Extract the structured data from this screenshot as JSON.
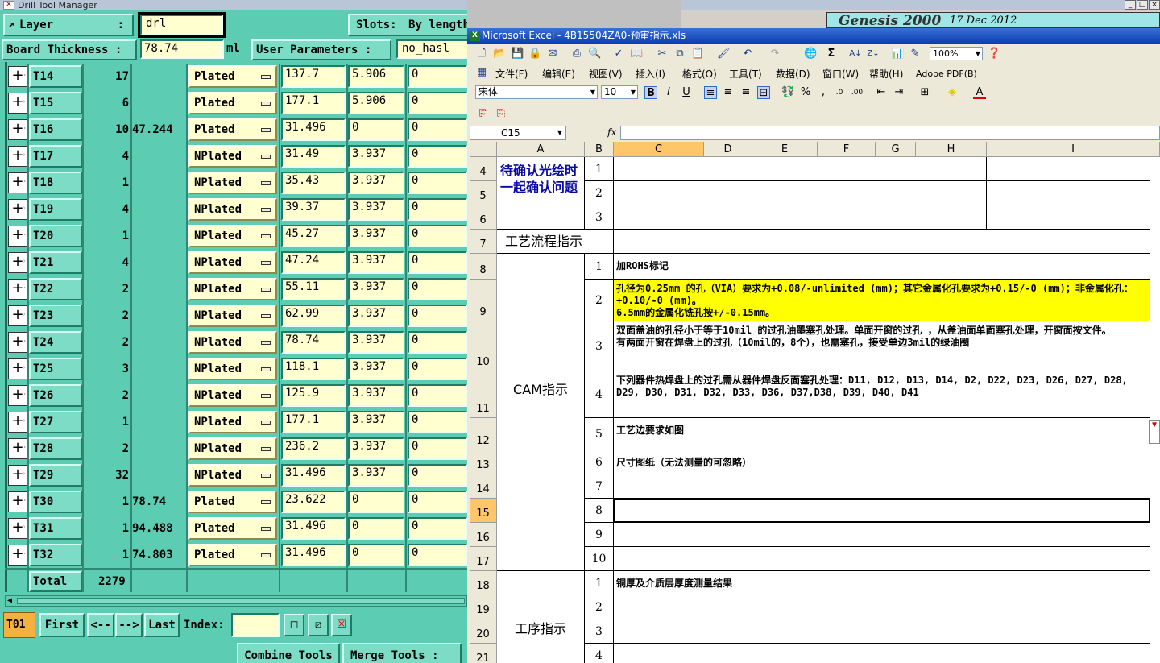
{
  "dtm": {
    "window_title": "Drill Tool Manager",
    "layer_label": "Layer",
    "layer_value": "drl",
    "slots_label": "Slots:",
    "slots_value": "By length",
    "board_thickness_label": "Board Thickness :",
    "board_thickness_value": "78.74",
    "board_thickness_unit": "ml",
    "user_params_label": "User Parameters :",
    "user_params_value": "no_hasl",
    "tools": [
      {
        "name": "T14",
        "count": "17",
        "size": "",
        "type": "Plated",
        "v1": "137.7",
        "v2": "5.906",
        "v3": "0"
      },
      {
        "name": "T15",
        "count": "6",
        "size": "",
        "type": "Plated",
        "v1": "177.1",
        "v2": "5.906",
        "v3": "0"
      },
      {
        "name": "T16",
        "count": "10",
        "size": "47.244",
        "type": "Plated",
        "v1": "31.496",
        "v2": "0",
        "v3": "0"
      },
      {
        "name": "T17",
        "count": "4",
        "size": "",
        "type": "NPlated",
        "v1": "31.49",
        "v2": "3.937",
        "v3": "0"
      },
      {
        "name": "T18",
        "count": "1",
        "size": "",
        "type": "NPlated",
        "v1": "35.43",
        "v2": "3.937",
        "v3": "0"
      },
      {
        "name": "T19",
        "count": "4",
        "size": "",
        "type": "NPlated",
        "v1": "39.37",
        "v2": "3.937",
        "v3": "0"
      },
      {
        "name": "T20",
        "count": "1",
        "size": "",
        "type": "NPlated",
        "v1": "45.27",
        "v2": "3.937",
        "v3": "0"
      },
      {
        "name": "T21",
        "count": "4",
        "size": "",
        "type": "NPlated",
        "v1": "47.24",
        "v2": "3.937",
        "v3": "0"
      },
      {
        "name": "T22",
        "count": "2",
        "size": "",
        "type": "NPlated",
        "v1": "55.11",
        "v2": "3.937",
        "v3": "0"
      },
      {
        "name": "T23",
        "count": "2",
        "size": "",
        "type": "NPlated",
        "v1": "62.99",
        "v2": "3.937",
        "v3": "0"
      },
      {
        "name": "T24",
        "count": "2",
        "size": "",
        "type": "NPlated",
        "v1": "78.74",
        "v2": "3.937",
        "v3": "0"
      },
      {
        "name": "T25",
        "count": "3",
        "size": "",
        "type": "NPlated",
        "v1": "118.1",
        "v2": "3.937",
        "v3": "0"
      },
      {
        "name": "T26",
        "count": "2",
        "size": "",
        "type": "NPlated",
        "v1": "125.9",
        "v2": "3.937",
        "v3": "0"
      },
      {
        "name": "T27",
        "count": "1",
        "size": "",
        "type": "NPlated",
        "v1": "177.1",
        "v2": "3.937",
        "v3": "0"
      },
      {
        "name": "T28",
        "count": "2",
        "size": "",
        "type": "NPlated",
        "v1": "236.2",
        "v2": "3.937",
        "v3": "0"
      },
      {
        "name": "T29",
        "count": "32",
        "size": "",
        "type": "NPlated",
        "v1": "31.496",
        "v2": "3.937",
        "v3": "0"
      },
      {
        "name": "T30",
        "count": "1",
        "size": "78.74",
        "type": "Plated",
        "v1": "23.622",
        "v2": "0",
        "v3": "0"
      },
      {
        "name": "T31",
        "count": "1",
        "size": "94.488",
        "type": "Plated",
        "v1": "31.496",
        "v2": "0",
        "v3": "0"
      },
      {
        "name": "T32",
        "count": "1",
        "size": "74.803",
        "type": "Plated",
        "v1": "31.496",
        "v2": "0",
        "v3": "0"
      }
    ],
    "total_label": "Total",
    "total_value": "2279",
    "current_tool": "T01",
    "first_label": "First",
    "prev_label": "<--",
    "next_label": "-->",
    "last_label": "Last",
    "index_label": "Index:",
    "combine_label": "Combine Tools",
    "merge_label": "Merge Tools :"
  },
  "genesis": {
    "title": "Genesis 2000",
    "date": "17 Dec 2012"
  },
  "excel": {
    "title": "Microsoft Excel - 4B15504ZA0-预审指示.xls",
    "menus": [
      "文件(F)",
      "编辑(E)",
      "视图(V)",
      "插入(I)",
      "格式(O)",
      "工具(T)",
      "数据(D)",
      "窗口(W)",
      "帮助(H)",
      "Adobe PDF(B)"
    ],
    "font_name": "宋体",
    "font_size": "10",
    "zoom": "100%",
    "name_box": "C15",
    "fx": "fx",
    "columns": [
      "A",
      "B",
      "C",
      "D",
      "E",
      "F",
      "G",
      "H",
      "I"
    ],
    "rows": [
      "4",
      "5",
      "6",
      "7",
      "8",
      "9",
      "10",
      "11",
      "12",
      "13",
      "14",
      "15",
      "16",
      "17",
      "18",
      "19",
      "20",
      "21"
    ],
    "section1_title": "待确认光绘时一起确认问题",
    "section1_nums": [
      "1",
      "2",
      "3"
    ],
    "process_title": "工艺流程指示",
    "cam_title": "CAM指示",
    "cam_items": [
      {
        "num": "1",
        "text": "加ROHS标记"
      },
      {
        "num": "2",
        "text": "孔径为0.25mm 的孔（VIA）要求为+0.08/-unlimited (mm)；其它金属化孔要求为+0.15/-0 (mm)；非金属化孔：+0.10/-0 (mm)。\n6.5mm的金属化铣孔按+/-0.15mm。"
      },
      {
        "num": "3",
        "text": "双面盖油的孔径小于等于10mil 的过孔油墨塞孔处理。单面开窗的过孔 ，从盖油面单面塞孔处理，开窗面按文件。\n有两面开窗在焊盘上的过孔（10mil的，8个），也需塞孔，接受单边3mil的绿油圈"
      },
      {
        "num": "4",
        "text": "下列器件热焊盘上的过孔需从器件焊盘反面塞孔处理：D11, D12, D13, D14, D2, D22, D23, D26, D27, D28, D29, D30, D31, D32, D33, D36, D37,D38, D39, D40, D41"
      },
      {
        "num": "5",
        "text": "工艺边要求如图"
      },
      {
        "num": "6",
        "text": "尺寸图纸（无法测量的可忽略）"
      },
      {
        "num": "7",
        "text": ""
      },
      {
        "num": "8",
        "text": ""
      },
      {
        "num": "9",
        "text": ""
      },
      {
        "num": "10",
        "text": ""
      }
    ],
    "proc_title": "工序指示",
    "proc_items": [
      {
        "num": "1",
        "text": "铜厚及介质层厚度测量结果"
      },
      {
        "num": "2",
        "text": ""
      },
      {
        "num": "3",
        "text": ""
      },
      {
        "num": "4",
        "text": ""
      }
    ],
    "highlight_color": "#ffff00"
  }
}
